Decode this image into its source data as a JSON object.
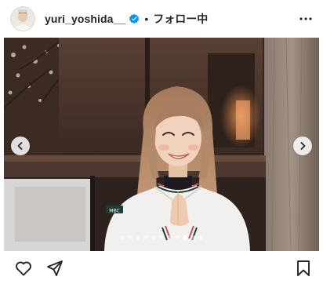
{
  "header": {
    "username": "yuri_yoshida__",
    "separator": "•",
    "follow_label": "フォロー中",
    "verified_icon": "verified-badge-icon",
    "more_icon": "more-horizontal-icon"
  },
  "media": {
    "badge_text": "MBC",
    "carousel": {
      "slides": 11,
      "active_index": 8
    },
    "prev_icon": "chevron-left-icon",
    "next_icon": "chevron-right-icon"
  },
  "actions": {
    "like_icon": "heart-icon",
    "share_icon": "send-icon",
    "save_icon": "bookmark-icon"
  },
  "colors": {
    "verified_blue": "#0095f6",
    "text": "#262626"
  }
}
